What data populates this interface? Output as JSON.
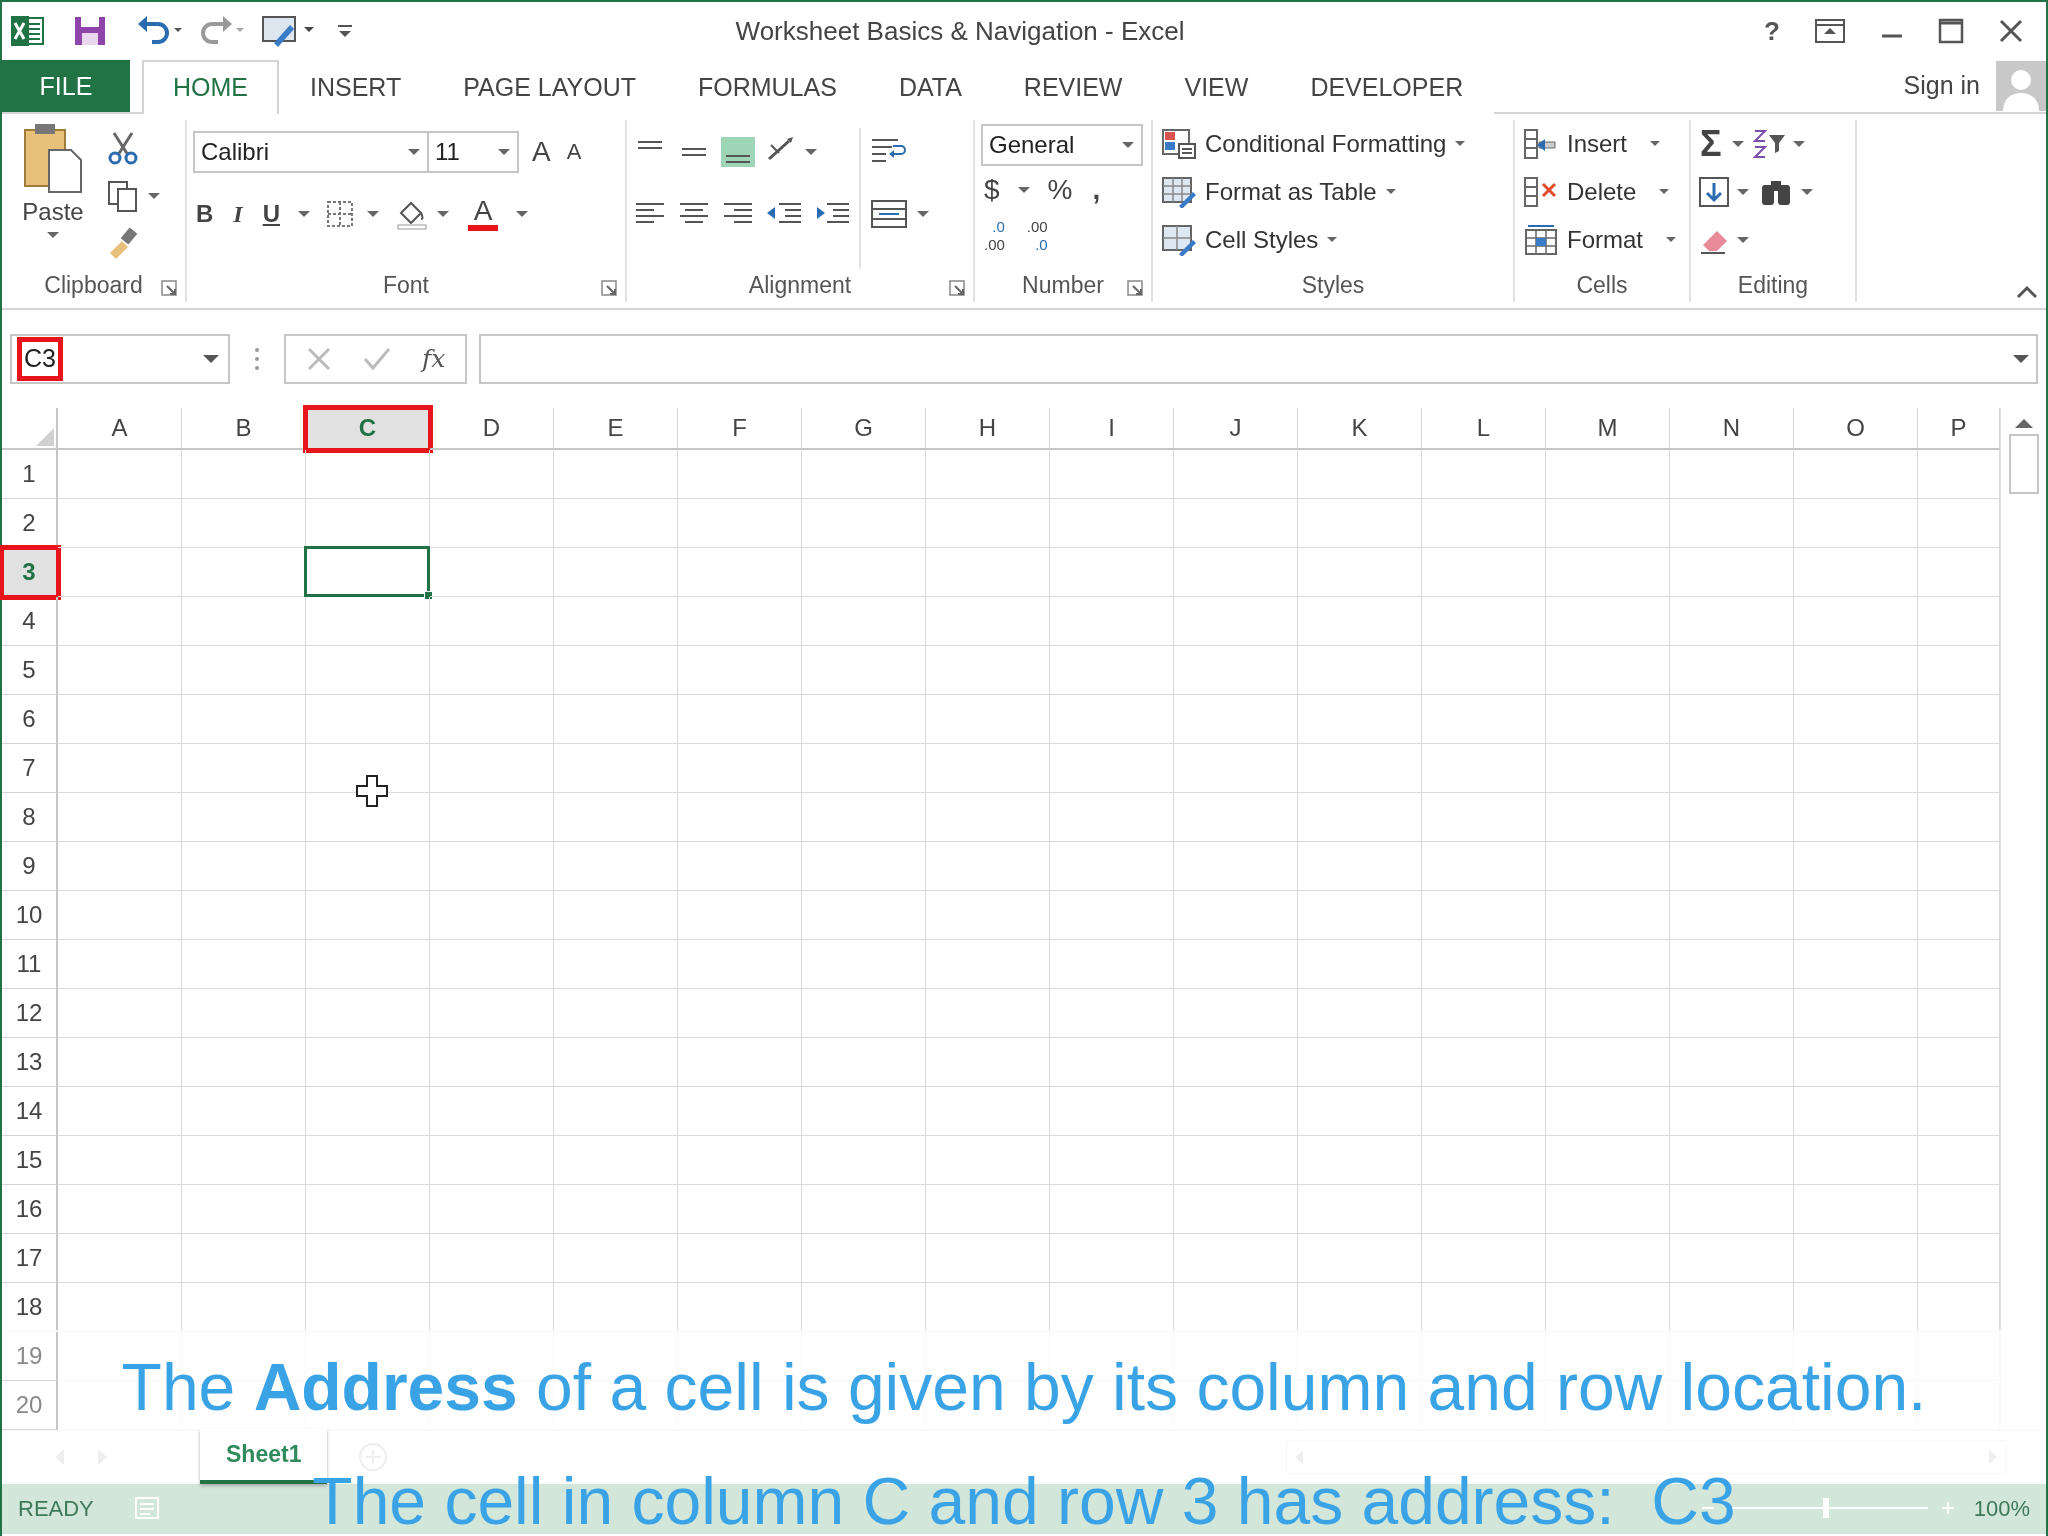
{
  "title_bar": {
    "title": "Worksheet Basics & Navigation - Excel",
    "help": "?"
  },
  "ribbon_tabs": [
    {
      "label": "FILE",
      "kind": "file",
      "selected": false
    },
    {
      "label": "HOME",
      "kind": "tab",
      "selected": true
    },
    {
      "label": "INSERT",
      "kind": "tab",
      "selected": false
    },
    {
      "label": "PAGE LAYOUT",
      "kind": "tab",
      "selected": false
    },
    {
      "label": "FORMULAS",
      "kind": "tab",
      "selected": false
    },
    {
      "label": "DATA",
      "kind": "tab",
      "selected": false
    },
    {
      "label": "REVIEW",
      "kind": "tab",
      "selected": false
    },
    {
      "label": "VIEW",
      "kind": "tab",
      "selected": false
    },
    {
      "label": "DEVELOPER",
      "kind": "tab",
      "selected": false
    }
  ],
  "account": {
    "label": "Sign in"
  },
  "ribbon": {
    "clipboard": {
      "paste": "Paste",
      "group_label": "Clipboard"
    },
    "font": {
      "font_name": "Calibri",
      "font_size": "11",
      "grow": "A",
      "shrink": "A",
      "bold": "B",
      "italic": "I",
      "underline": "U",
      "font_color": "A",
      "group_label": "Font"
    },
    "alignment": {
      "vertical_align": [
        {
          "selected": false
        },
        {
          "selected": false
        },
        {
          "selected": true
        }
      ],
      "group_label": "Alignment"
    },
    "number": {
      "format": "General",
      "currency": "$",
      "percent": "%",
      "comma": ",",
      "increase_decimal": [
        ".0",
        ".00"
      ],
      "decrease_decimal": [
        ".00",
        ".0"
      ],
      "group_label": "Number"
    },
    "styles": {
      "buttons": [
        "Conditional Formatting",
        "Format as Table",
        "Cell Styles"
      ],
      "group_label": "Styles"
    },
    "cells": {
      "buttons": [
        "Insert",
        "Delete",
        "Format"
      ],
      "group_label": "Cells"
    },
    "editing": {
      "sum": "Σ",
      "group_label": "Editing"
    }
  },
  "formula_bar": {
    "name_box": "C3",
    "name_box_annotated": true,
    "function_label": "fx"
  },
  "grid": {
    "columns": [
      {
        "label": "A",
        "selected": false
      },
      {
        "label": "B",
        "selected": false
      },
      {
        "label": "C",
        "selected": true
      },
      {
        "label": "D",
        "selected": false
      },
      {
        "label": "E",
        "selected": false
      },
      {
        "label": "F",
        "selected": false
      },
      {
        "label": "G",
        "selected": false
      },
      {
        "label": "H",
        "selected": false
      },
      {
        "label": "I",
        "selected": false
      },
      {
        "label": "J",
        "selected": false
      },
      {
        "label": "K",
        "selected": false
      },
      {
        "label": "L",
        "selected": false
      },
      {
        "label": "M",
        "selected": false
      },
      {
        "label": "N",
        "selected": false
      },
      {
        "label": "O",
        "selected": false
      },
      {
        "label": "P",
        "selected": false
      }
    ],
    "rows": [
      {
        "label": "1",
        "selected": false
      },
      {
        "label": "2",
        "selected": false
      },
      {
        "label": "3",
        "selected": true
      },
      {
        "label": "4",
        "selected": false
      },
      {
        "label": "5",
        "selected": false
      },
      {
        "label": "6",
        "selected": false
      },
      {
        "label": "7",
        "selected": false
      },
      {
        "label": "8",
        "selected": false
      },
      {
        "label": "9",
        "selected": false
      },
      {
        "label": "10",
        "selected": false
      },
      {
        "label": "11",
        "selected": false
      },
      {
        "label": "12",
        "selected": false
      },
      {
        "label": "13",
        "selected": false
      },
      {
        "label": "14",
        "selected": false
      },
      {
        "label": "15",
        "selected": false
      },
      {
        "label": "16",
        "selected": false
      },
      {
        "label": "17",
        "selected": false
      },
      {
        "label": "18",
        "selected": false
      },
      {
        "label": "19",
        "selected": false
      },
      {
        "label": "20",
        "selected": false
      }
    ],
    "headers_annotated": true
  },
  "sheet_tabs": [
    {
      "label": "Sheet1",
      "selected": true
    }
  ],
  "status_bar": {
    "status": "READY",
    "zoom": "100%"
  },
  "caption": {
    "lines": [
      "The **Address** of a cell is given by its column and row location.",
      "The cell in column C and row 3 has address:  C3"
    ]
  }
}
